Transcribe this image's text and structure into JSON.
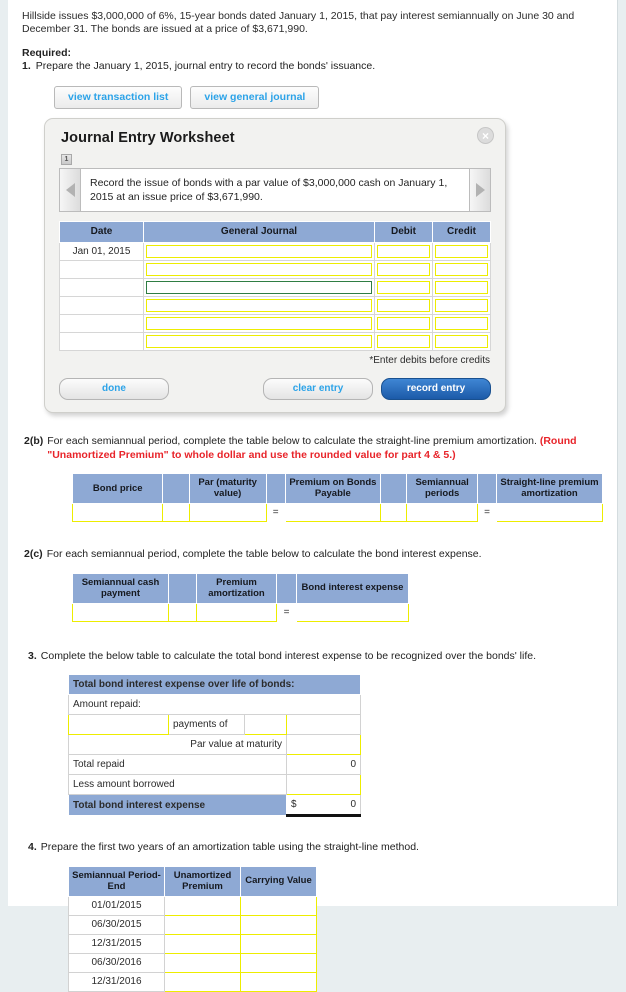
{
  "intro": {
    "paragraph": "Hillside issues $3,000,000 of 6%, 15-year bonds dated January 1, 2015, that pay interest semiannually on June 30 and December 31. The bonds are issued at a price of $3,671,990.",
    "required_label": "Required:",
    "req1_num": "1.",
    "req1_text": "Prepare the January 1, 2015, journal entry to record the bonds' issuance."
  },
  "view_buttons": {
    "transaction_list": "view transaction list",
    "general_journal": "view general journal"
  },
  "worksheet": {
    "title": "Journal Entry Worksheet",
    "close_label": "×",
    "step_badge": "1",
    "prompt": "Record the issue of bonds with a par value of $3,000,000 cash on January 1, 2015 at an issue price of $3,671,990.",
    "columns": [
      "Date",
      "General Journal",
      "Debit",
      "Credit"
    ],
    "rows": [
      {
        "date": "Jan 01, 2015",
        "focused": false
      },
      {
        "date": "",
        "focused": false
      },
      {
        "date": "",
        "focused": true
      },
      {
        "date": "",
        "focused": false
      },
      {
        "date": "",
        "focused": false
      },
      {
        "date": "",
        "focused": false
      }
    ],
    "note": "*Enter debits before credits",
    "buttons": {
      "done": "done",
      "clear_entry": "clear entry",
      "record_entry": "record entry"
    }
  },
  "section_2b": {
    "num": "2(b)",
    "text_plain": "For each semiannual period, complete the table below to calculate the straight-line premium amortization. ",
    "text_red": "(Round \"Unamortized Premium\" to whole dollar and use the rounded value for part 4 & 5.)",
    "columns": [
      "Bond price",
      "Par (maturity value)",
      "Premium on Bonds Payable",
      "Semiannual periods",
      "Straight-line premium amortization"
    ],
    "operator_equals": "="
  },
  "section_2c": {
    "num": "2(c)",
    "text": "For each semiannual period, complete the table below to calculate the bond interest expense.",
    "columns": [
      "Semiannual cash payment",
      "Premium amortization",
      "Bond interest expense"
    ],
    "operator_equals": "="
  },
  "section_3": {
    "num": "3.",
    "text": "Complete the below table to calculate the total bond interest expense to be recognized over the bonds' life.",
    "header": "Total bond interest expense over life of bonds:",
    "amount_repaid_label": "Amount repaid:",
    "payments_of_label": "payments of",
    "par_value_label": "Par value at maturity",
    "total_repaid_label": "Total repaid",
    "total_repaid_value": "0",
    "less_borrowed_label": "Less amount borrowed",
    "total_expense_label": "Total bond interest expense",
    "total_expense_sign": "$",
    "total_expense_value": "0"
  },
  "section_4": {
    "num": "4.",
    "text": "Prepare the first two years of an amortization table using the straight-line method.",
    "columns": [
      "Semiannual Period-End",
      "Unamortized Premium",
      "Carrying Value"
    ],
    "rows": [
      "01/01/2015",
      "06/30/2015",
      "12/31/2015",
      "06/30/2016",
      "12/31/2016"
    ]
  }
}
